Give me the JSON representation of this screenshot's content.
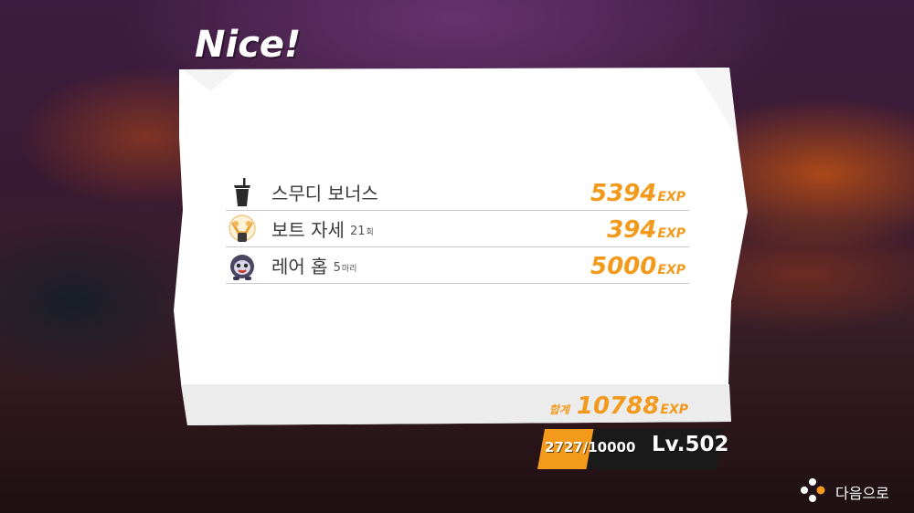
{
  "header": {
    "title": "Nice!"
  },
  "rewards": [
    {
      "label": "스무디 보너스",
      "sub": "",
      "unit": "",
      "value": "5394",
      "exp": "EXP",
      "icon": "smoothie-cup-icon"
    },
    {
      "label": "보트 자세",
      "sub": "21",
      "unit": "회",
      "value": "394",
      "exp": "EXP",
      "icon": "boat-pose-icon"
    },
    {
      "label": "레어 홉",
      "sub": "5",
      "unit": "마리",
      "value": "5000",
      "exp": "EXP",
      "icon": "rare-hop-icon"
    }
  ],
  "total": {
    "label": "합계",
    "value": "10788",
    "exp": "EXP"
  },
  "level": {
    "progress_text": "2727/10000",
    "progress_fraction": 0.2727,
    "level_text": "Lv.502"
  },
  "footer": {
    "next_label": "다음으로",
    "next_icon": "controller-buttons-icon"
  },
  "colors": {
    "accent": "#f39a1c",
    "panel": "#ffffff",
    "panel_footer": "#ececec"
  }
}
